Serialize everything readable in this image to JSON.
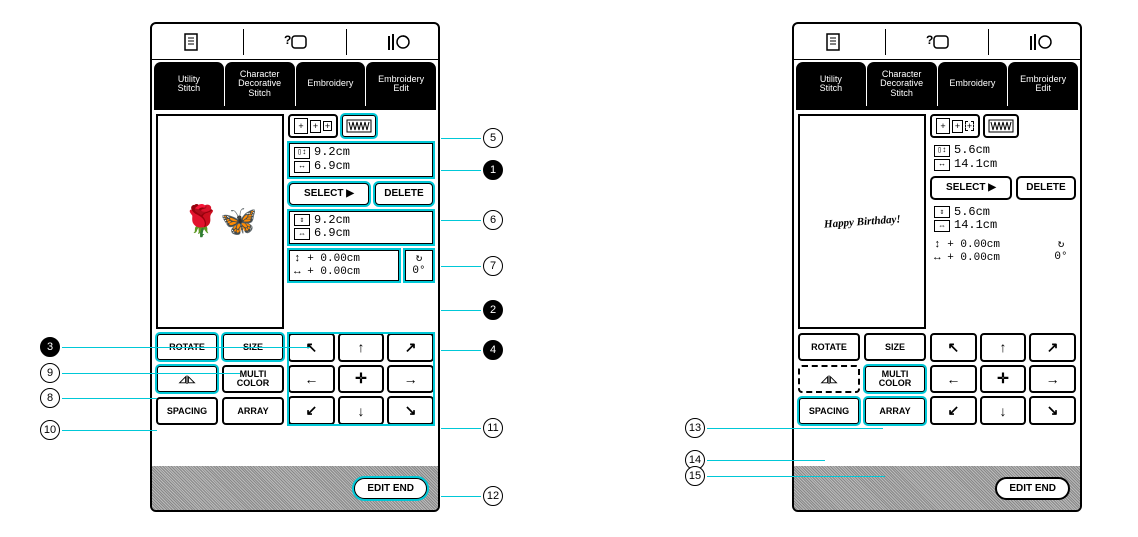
{
  "top_icons": [
    "page-icon",
    "help-icon",
    "threadchange-icon"
  ],
  "tabs": {
    "utility": "Utility\nStitch",
    "decorative": "Character\nDecorative\nStitch",
    "embroidery": "Embroidery",
    "edit": "Embroidery\nEdit"
  },
  "left": {
    "preview_content": "rose",
    "frame_dims": {
      "h": "9.2cm",
      "w": "6.9cm"
    },
    "select_label": "SELECT ▶",
    "delete_label": "DELETE",
    "pattern_dims": {
      "h": "9.2cm",
      "w": "6.9cm"
    },
    "offset": {
      "v": "+ 0.00cm",
      "h": "+ 0.00cm"
    },
    "rotation": "0°",
    "buttons": {
      "rotate": "ROTATE",
      "size": "SIZE",
      "mirror": "◿|◺",
      "multicolor": "MULTI\nCOLOR",
      "spacing": "SPACING",
      "array": "ARRAY"
    },
    "editend": "EDIT END"
  },
  "right": {
    "preview_content": "Happy Birthday!",
    "frame_dims": {
      "h": "5.6cm",
      "w": "14.1cm"
    },
    "select_label": "SELECT ▶",
    "delete_label": "DELETE",
    "pattern_dims": {
      "h": "5.6cm",
      "w": "14.1cm"
    },
    "offset": {
      "v": "+ 0.00cm",
      "h": "+ 0.00cm"
    },
    "rotation": "0°",
    "buttons": {
      "rotate": "ROTATE",
      "size": "SIZE",
      "mirror": "◿|◺",
      "multicolor": "MULTI\nCOLOR",
      "spacing": "SPACING",
      "array": "ARRAY"
    },
    "editend": "EDIT END"
  },
  "dpad": [
    "↖",
    "↑",
    "↗",
    "←",
    "✛",
    "→",
    "↙",
    "↓",
    "↘"
  ],
  "callouts_left": {
    "c1": "1",
    "c2": "2",
    "c3": "3",
    "c4": "4",
    "c5": "5",
    "c6": "6",
    "c7": "7",
    "c8": "8",
    "c9": "9",
    "c10": "10",
    "c11": "11",
    "c12": "12"
  },
  "callouts_right": {
    "c13": "13",
    "c14": "14",
    "c15": "15"
  }
}
